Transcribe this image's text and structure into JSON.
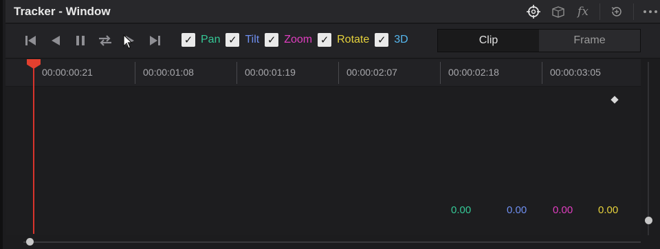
{
  "window": {
    "title": "Tracker - Window"
  },
  "titlebar_icons": [
    "crosshair-icon",
    "3d-box-icon",
    "fx-icon",
    "history-icon",
    "more-options-icon"
  ],
  "titlebar_fx_label": "fx",
  "transport": [
    "go-to-start-icon",
    "play-reverse-icon",
    "pause-icon",
    "loop-icon",
    "play-forward-icon",
    "go-to-end-icon"
  ],
  "checks": [
    {
      "label": "Pan",
      "color": "#35c896",
      "checked": true
    },
    {
      "label": "Tilt",
      "color": "#6f8ff0",
      "checked": true
    },
    {
      "label": "Zoom",
      "color": "#e03ec0",
      "checked": true
    },
    {
      "label": "Rotate",
      "color": "#e6d23c",
      "checked": true
    },
    {
      "label": "3D",
      "color": "#56b8f0",
      "checked": true
    }
  ],
  "mode": {
    "clip": "Clip",
    "frame": "Frame",
    "selected": "Clip"
  },
  "timeline": {
    "timecodes": [
      "00:00:00:21",
      "00:00:01:08",
      "00:00:01:19",
      "00:00:02:07",
      "00:00:02:18",
      "00:00:03:05"
    ],
    "playhead_color": "#e2402f"
  },
  "values": {
    "pan": "0.00",
    "tilt": "0.00",
    "zoom": "0.00",
    "rotate": "0.00"
  },
  "value_colors": {
    "pan": "#35c896",
    "tilt": "#6f8ff0",
    "zoom": "#e03ec0",
    "rotate": "#e6d23c"
  }
}
